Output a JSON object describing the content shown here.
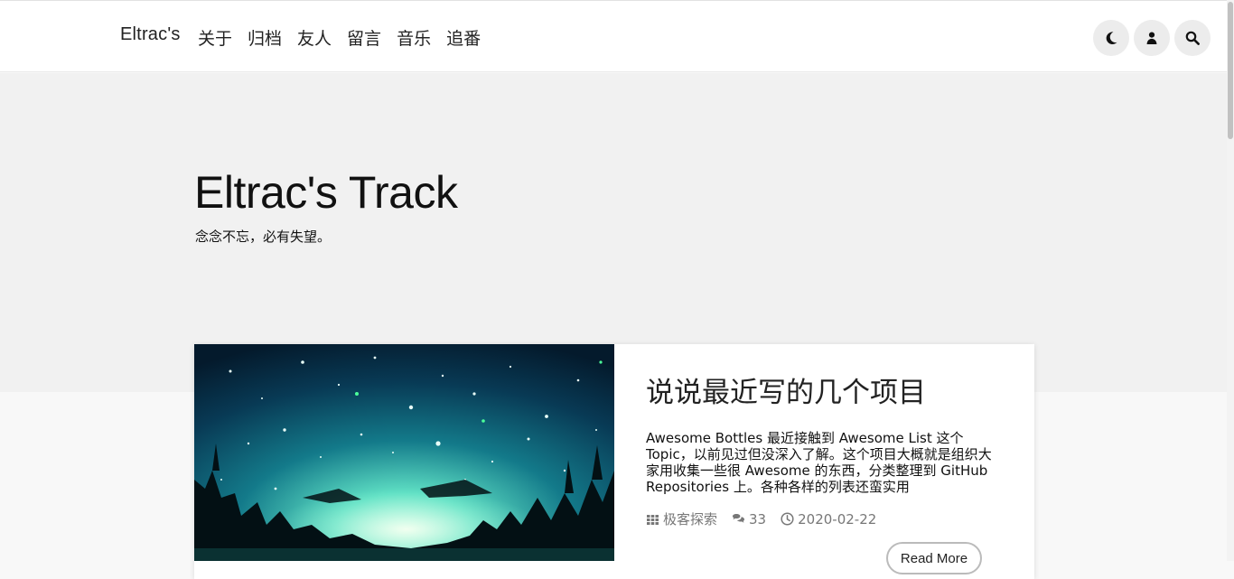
{
  "header": {
    "brand": "Eltrac's",
    "nav": [
      "关于",
      "归档",
      "友人",
      "留言",
      "音乐",
      "追番"
    ],
    "icons": [
      "moon-icon",
      "user-icon",
      "search-icon"
    ]
  },
  "hero": {
    "title": "Eltrac's Track",
    "subtitle": "念念不忘，必有失望。"
  },
  "post": {
    "title": "说说最近写的几个项目",
    "excerpt": "Awesome Bottles 最近接触到 Awesome List 这个 Topic，以前见过但没深入了解。这个项目大概就是组织大家用收集一些很 Awesome 的东西，分类整理到 GitHub Repositories 上。各种各样的列表还蛮实用",
    "category": "极客探索",
    "comments": "33",
    "date": "2020-02-22",
    "read_more": "Read More"
  },
  "colors": {
    "hero_bg": "#f1f1f1",
    "header_bg": "#ffffff",
    "icon_button_bg": "#ececec"
  }
}
